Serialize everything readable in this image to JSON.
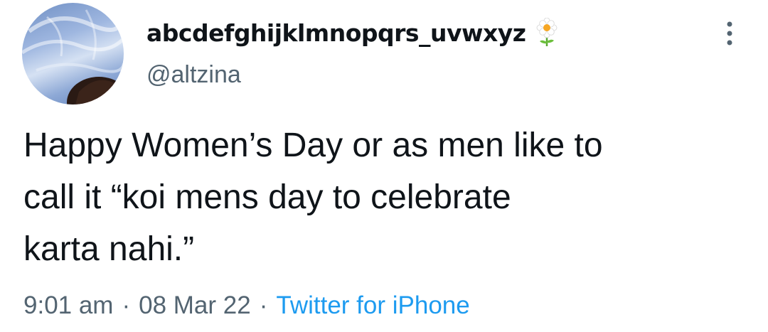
{
  "tweet": {
    "author": {
      "display_name": "abcdefghijklmnopqrs_uvwxyz",
      "handle": "@altzina",
      "avatar_icon": "profile-photo",
      "name_emoji_icon": "flower-icon"
    },
    "text": "Happy Women’s Day or as men like to\ncall it “koi mens day to celebrate\nkarta nahi.”",
    "meta": {
      "time": "9:01 am",
      "separator": "·",
      "date": "08 Mar 22",
      "source": "Twitter for iPhone"
    },
    "menu_icon": "more-options-icon"
  },
  "colors": {
    "text_primary": "#0f1419",
    "text_secondary": "#536471",
    "link": "#1d9bf0",
    "background": "#ffffff"
  }
}
